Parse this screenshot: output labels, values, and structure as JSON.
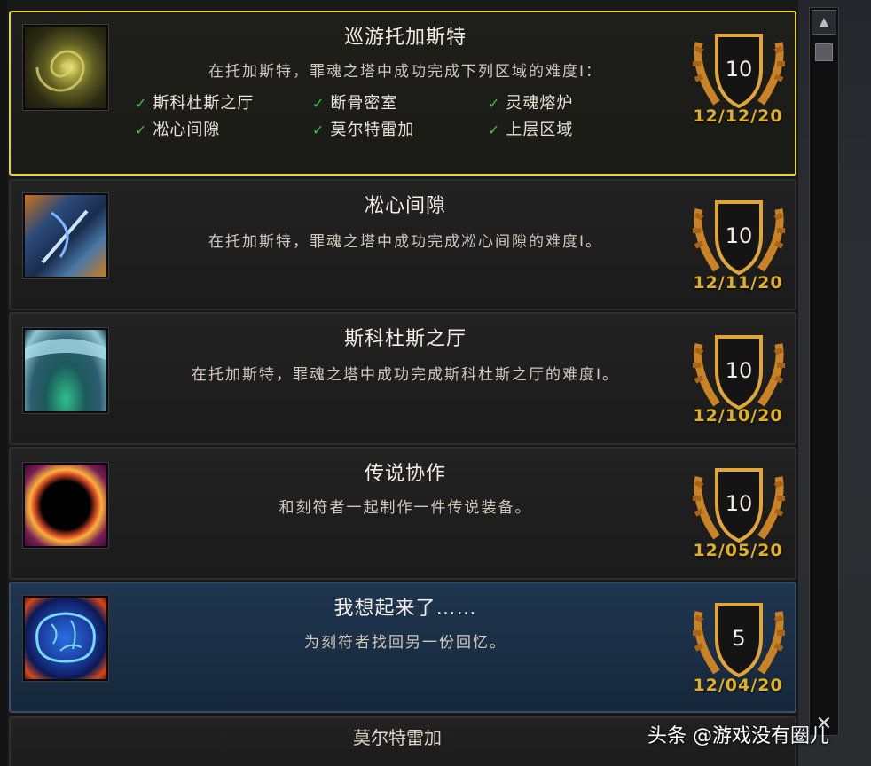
{
  "achievements": [
    {
      "title": "巡游托加斯特",
      "description": "在托加斯特，罪魂之塔中成功完成下列区域的难度Ⅰ：",
      "points": "10",
      "date": "12/12/20",
      "icon": "golden-vortex-icon",
      "criteria": [
        "斯科杜斯之厅",
        "断骨密室",
        "灵魂熔炉",
        "凇心间隙",
        "莫尔特雷加",
        "上层区域"
      ]
    },
    {
      "title": "凇心间隙",
      "description": "在托加斯特，罪魂之塔中成功完成凇心间隙的难度Ⅰ。",
      "points": "10",
      "date": "12/11/20",
      "icon": "frost-sword-icon"
    },
    {
      "title": "斯科杜斯之厅",
      "description": "在托加斯特，罪魂之塔中成功完成斯科杜斯之厅的难度Ⅰ。",
      "points": "10",
      "date": "12/10/20",
      "icon": "ice-cave-icon"
    },
    {
      "title": "传说协作",
      "description": "和刻符者一起制作一件传说装备。",
      "points": "10",
      "date": "12/05/20",
      "icon": "flame-silhouette-icon"
    },
    {
      "title": "我想起来了……",
      "description": "为刻符者找回另一份回忆。",
      "points": "5",
      "date": "12/04/20",
      "icon": "blue-brain-icon"
    }
  ],
  "next_partial_title": "莫尔特雷加",
  "scrollbar": {
    "up": "▲",
    "down": "✕"
  },
  "watermark": "头条 @游戏没有圈儿",
  "colors": {
    "selected_border": "#e6d23a",
    "date_gold": "#e4b11e",
    "check_green": "#3ec43a"
  }
}
